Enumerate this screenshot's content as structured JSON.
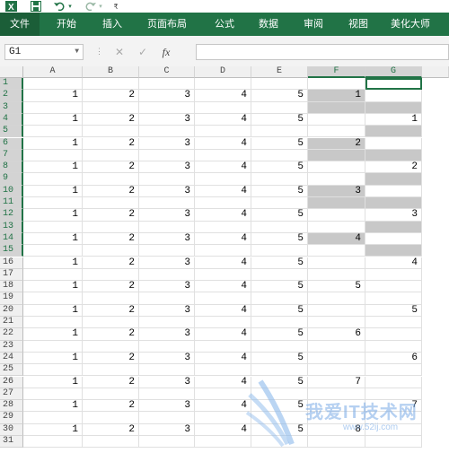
{
  "title_bar": {
    "app_icon": "excel-icon",
    "save_icon": "save-icon",
    "undo_icon": "undo-icon",
    "redo_icon": "redo-icon",
    "customize_icon": "customize-quick-access-icon"
  },
  "ribbon": {
    "tabs": [
      {
        "label": "文件",
        "active": true
      },
      {
        "label": "开始"
      },
      {
        "label": "插入"
      },
      {
        "label": "页面布局"
      },
      {
        "label": "公式"
      },
      {
        "label": "数据"
      },
      {
        "label": "审阅"
      },
      {
        "label": "视图"
      },
      {
        "label": "美化大师"
      }
    ],
    "color": "#217346"
  },
  "formula_bar": {
    "name_box": "G1",
    "cancel_icon": "✕",
    "enter_icon": "✓",
    "fx_label": "fx",
    "formula": ""
  },
  "sheet": {
    "columns": [
      "A",
      "B",
      "C",
      "D",
      "E",
      "F",
      "G"
    ],
    "selected_columns": [
      "F",
      "G"
    ],
    "rows": [
      {
        "n": "1",
        "cells": [
          "",
          "",
          "",
          "",
          "",
          "",
          ""
        ]
      },
      {
        "n": "2",
        "cells": [
          "1",
          "2",
          "3",
          "4",
          "5",
          "1",
          ""
        ]
      },
      {
        "n": "3",
        "cells": [
          "",
          "",
          "",
          "",
          "",
          "",
          ""
        ]
      },
      {
        "n": "4",
        "cells": [
          "1",
          "2",
          "3",
          "4",
          "5",
          "",
          "1"
        ]
      },
      {
        "n": "5",
        "cells": [
          "",
          "",
          "",
          "",
          "",
          "",
          ""
        ]
      },
      {
        "n": "6",
        "cells": [
          "1",
          "2",
          "3",
          "4",
          "5",
          "2",
          ""
        ]
      },
      {
        "n": "7",
        "cells": [
          "",
          "",
          "",
          "",
          "",
          "",
          ""
        ]
      },
      {
        "n": "8",
        "cells": [
          "1",
          "2",
          "3",
          "4",
          "5",
          "",
          "2"
        ]
      },
      {
        "n": "9",
        "cells": [
          "",
          "",
          "",
          "",
          "",
          "",
          ""
        ]
      },
      {
        "n": "10",
        "cells": [
          "1",
          "2",
          "3",
          "4",
          "5",
          "3",
          ""
        ]
      },
      {
        "n": "11",
        "cells": [
          "",
          "",
          "",
          "",
          "",
          "",
          ""
        ]
      },
      {
        "n": "12",
        "cells": [
          "1",
          "2",
          "3",
          "4",
          "5",
          "",
          "3"
        ]
      },
      {
        "n": "13",
        "cells": [
          "",
          "",
          "",
          "",
          "",
          "",
          ""
        ]
      },
      {
        "n": "14",
        "cells": [
          "1",
          "2",
          "3",
          "4",
          "5",
          "4",
          ""
        ]
      },
      {
        "n": "15",
        "cells": [
          "",
          "",
          "",
          "",
          "",
          "",
          ""
        ]
      },
      {
        "n": "16",
        "cells": [
          "1",
          "2",
          "3",
          "4",
          "5",
          "",
          "4"
        ]
      },
      {
        "n": "17",
        "cells": [
          "",
          "",
          "",
          "",
          "",
          "",
          ""
        ]
      },
      {
        "n": "18",
        "cells": [
          "1",
          "2",
          "3",
          "4",
          "5",
          "5",
          ""
        ]
      },
      {
        "n": "19",
        "cells": [
          "",
          "",
          "",
          "",
          "",
          "",
          ""
        ]
      },
      {
        "n": "20",
        "cells": [
          "1",
          "2",
          "3",
          "4",
          "5",
          "",
          "5"
        ]
      },
      {
        "n": "21",
        "cells": [
          "",
          "",
          "",
          "",
          "",
          "",
          ""
        ]
      },
      {
        "n": "22",
        "cells": [
          "1",
          "2",
          "3",
          "4",
          "5",
          "6",
          ""
        ]
      },
      {
        "n": "23",
        "cells": [
          "",
          "",
          "",
          "",
          "",
          "",
          ""
        ]
      },
      {
        "n": "24",
        "cells": [
          "1",
          "2",
          "3",
          "4",
          "5",
          "",
          "6"
        ]
      },
      {
        "n": "25",
        "cells": [
          "",
          "",
          "",
          "",
          "",
          "",
          ""
        ]
      },
      {
        "n": "26",
        "cells": [
          "1",
          "2",
          "3",
          "4",
          "5",
          "7",
          ""
        ]
      },
      {
        "n": "27",
        "cells": [
          "",
          "",
          "",
          "",
          "",
          "",
          ""
        ]
      },
      {
        "n": "28",
        "cells": [
          "1",
          "2",
          "3",
          "4",
          "5",
          "",
          "7"
        ]
      },
      {
        "n": "29",
        "cells": [
          "",
          "",
          "",
          "",
          "",
          "",
          ""
        ]
      },
      {
        "n": "30",
        "cells": [
          "1",
          "2",
          "3",
          "4",
          "5",
          "8",
          ""
        ]
      },
      {
        "n": "31",
        "cells": [
          "",
          "",
          "",
          "",
          "",
          "",
          ""
        ]
      }
    ],
    "selected_rows": [
      "1",
      "2",
      "3",
      "4",
      "5",
      "6",
      "7",
      "8",
      "9",
      "10",
      "11",
      "12",
      "13",
      "14",
      "15"
    ],
    "active_cell": "G1",
    "grey_cells": {
      "F": [
        "2",
        "3",
        "6",
        "7",
        "10",
        "11",
        "14"
      ],
      "G": [
        "3",
        "5",
        "7",
        "9",
        "11",
        "13",
        "15"
      ]
    },
    "grey_color": "#c8c8c8"
  },
  "watermark": {
    "text": "我爱IT技术网",
    "url": "www.52ij.com"
  }
}
